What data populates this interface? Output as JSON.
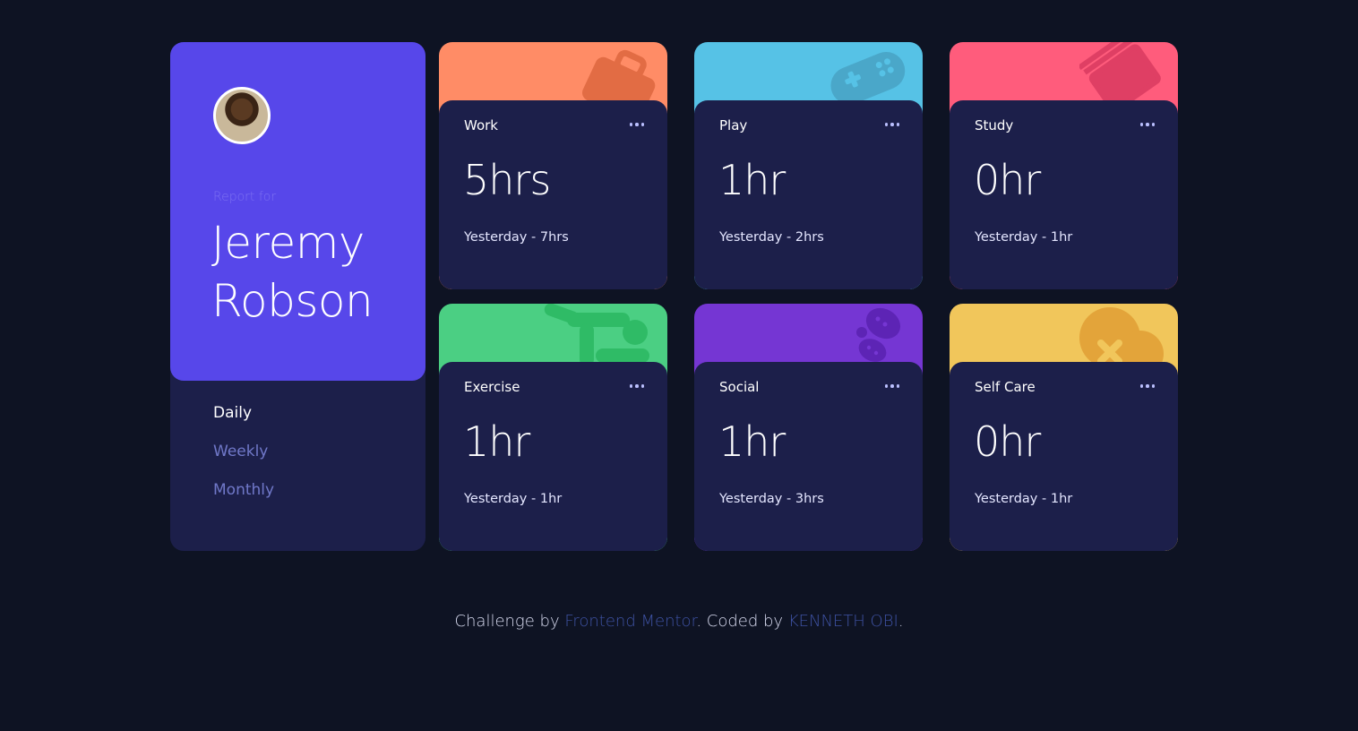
{
  "user": {
    "report_label": "Report for",
    "first_name": "Jeremy",
    "last_name": "Robson"
  },
  "periods": [
    {
      "label": "Daily",
      "active": true
    },
    {
      "label": "Weekly",
      "active": false
    },
    {
      "label": "Monthly",
      "active": false
    }
  ],
  "cards": [
    {
      "title": "Work",
      "current": "5hrs",
      "previous": "Yesterday - 7hrs",
      "color": "#ff8c66",
      "icon": "briefcase-icon"
    },
    {
      "title": "Play",
      "current": "1hr",
      "previous": "Yesterday - 2hrs",
      "color": "#56c2e6",
      "icon": "gamepad-icon"
    },
    {
      "title": "Study",
      "current": "0hr",
      "previous": "Yesterday - 1hr",
      "color": "#ff5c7c",
      "icon": "book-icon"
    },
    {
      "title": "Exercise",
      "current": "1hr",
      "previous": "Yesterday - 1hr",
      "color": "#4bcf83",
      "icon": "runner-icon"
    },
    {
      "title": "Social",
      "current": "1hr",
      "previous": "Yesterday - 3hrs",
      "color": "#7536d3",
      "icon": "chat-bubbles-icon"
    },
    {
      "title": "Self Care",
      "current": "0hr",
      "previous": "Yesterday - 1hr",
      "color": "#f1c65b",
      "icon": "heart-bandage-icon"
    }
  ],
  "footer": {
    "prefix": "Challenge by ",
    "link1": "Frontend Mentor",
    "middle": ". Coded by ",
    "link2": "KENNETH OBI",
    "suffix": "."
  }
}
